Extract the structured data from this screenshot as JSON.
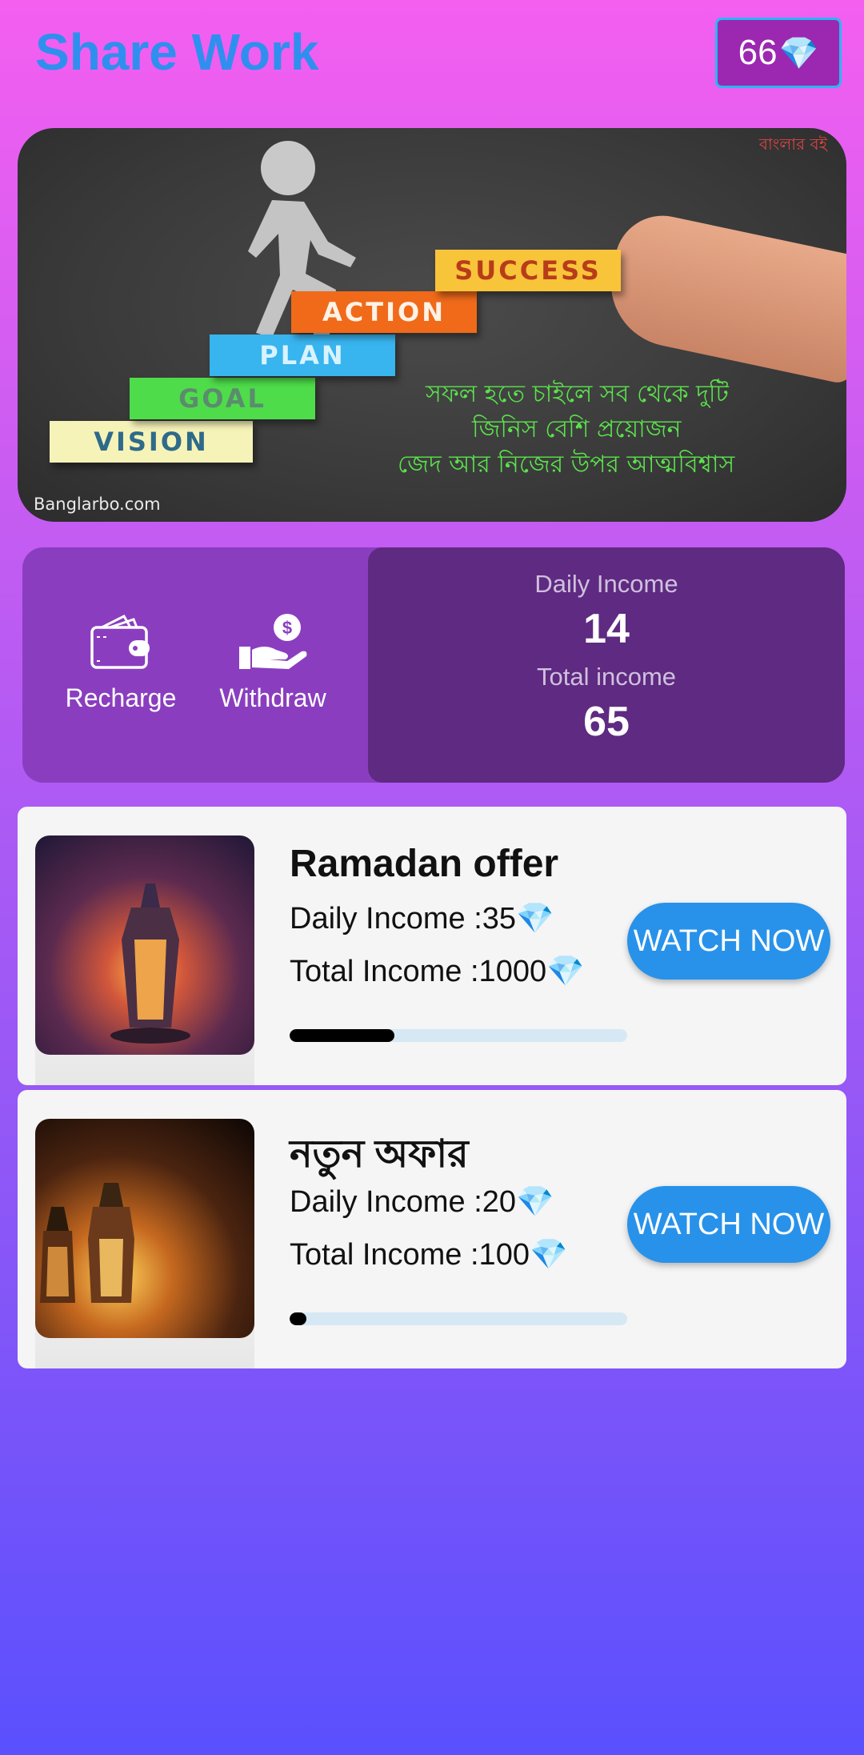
{
  "header": {
    "title": "Share Work",
    "gem_count": "66",
    "gem_icon": "💎"
  },
  "banner": {
    "steps": [
      "VISION",
      "GOAL",
      "PLAN",
      "ACTION",
      "SUCCESS"
    ],
    "bengali_lines": [
      "সফল হতে চাইলে সব থেকে দুটি",
      "জিনিস বেশি প্রয়োজন",
      "জেদ আর নিজের উপর আত্মবিশ্বাস"
    ],
    "watermark": "Banglarbo.com",
    "top_mark": "বাংলার বই"
  },
  "stats": {
    "recharge_label": "Recharge",
    "withdraw_label": "Withdraw",
    "daily_income_label": "Daily Income",
    "daily_income_value": "14",
    "total_income_label": "Total income",
    "total_income_value": "65"
  },
  "offers": [
    {
      "title": "Ramadan offer",
      "daily": "Daily Income :35💎",
      "total": "Total Income :1000💎",
      "progress": 0.31,
      "button": "WATCH NOW"
    },
    {
      "title": "নতুন অফার",
      "daily": "Daily Income :20💎",
      "total": "Total Income :100💎",
      "progress": 0.05,
      "button": "WATCH NOW"
    }
  ],
  "colors": {
    "title": "#2f8fee",
    "button": "#2892ea",
    "panel": "#5f2a82",
    "card": "#8a3ebf"
  }
}
